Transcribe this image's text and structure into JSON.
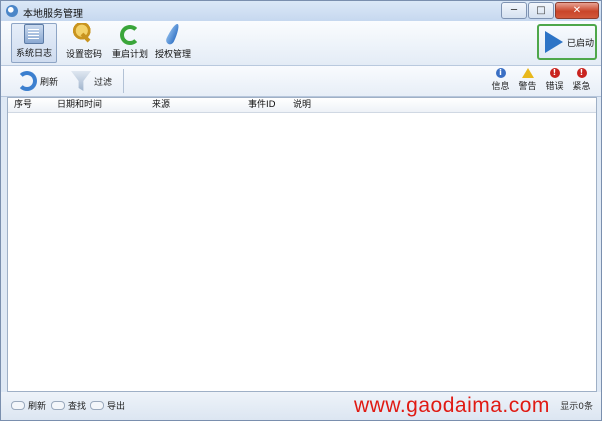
{
  "window": {
    "title": "本地服务管理",
    "minimize_label": "─",
    "maximize_label": "□",
    "close_label": "✕"
  },
  "toolbar": {
    "items": [
      {
        "label": "系统日志",
        "icon": "log-icon",
        "active": true
      },
      {
        "label": "设置密码",
        "icon": "key-icon"
      },
      {
        "label": "重启计划",
        "icon": "restart-icon"
      },
      {
        "label": "授权管理",
        "icon": "feather-icon"
      }
    ],
    "start_label": "已启动",
    "start_icon": "play-icon",
    "start_border_color": "#4ea74a"
  },
  "subtoolbar": {
    "refresh_label": "刷新",
    "filter_label": "过滤",
    "levels": [
      {
        "label": "信息",
        "icon": "info-icon",
        "color": "#3a6fc4"
      },
      {
        "label": "警告",
        "icon": "warning-icon",
        "color": "#e8b81c"
      },
      {
        "label": "错误",
        "icon": "error-icon",
        "color": "#c9231f"
      },
      {
        "label": "紧急",
        "icon": "critical-icon",
        "color": "#c9231f"
      }
    ]
  },
  "table": {
    "columns": [
      "序号",
      "日期和时间",
      "来源",
      "事件ID",
      "说明"
    ],
    "rows": []
  },
  "statusbar": {
    "refresh_label": "刷新",
    "find_label": "查找",
    "export_label": "导出",
    "right_text": "显示0条"
  },
  "watermark": "www.gaodaima.com"
}
